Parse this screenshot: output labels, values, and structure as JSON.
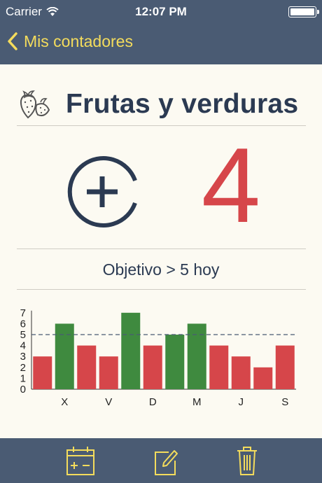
{
  "status_bar": {
    "carrier": "Carrier",
    "time": "12:07 PM"
  },
  "nav": {
    "back_label": "Mis contadores"
  },
  "counter": {
    "icon": "strawberry-icon",
    "title": "Frutas y verduras",
    "count": "4",
    "goal_text": "Objetivo > 5 hoy"
  },
  "toolbar": {
    "icons": [
      "calendar-add-icon",
      "edit-icon",
      "trash-icon"
    ]
  },
  "colors": {
    "nav_bg": "#4a5b73",
    "accent": "#f4dc5c",
    "count": "#d6464a",
    "bar_met": "#3f8a3f",
    "bar_unmet": "#d6464a",
    "goal_line": "#4a5b73"
  },
  "chart_data": {
    "type": "bar",
    "categories": [
      "",
      "X",
      "",
      "V",
      "",
      "D",
      "",
      "M",
      "",
      "J",
      "",
      "S"
    ],
    "values": [
      3,
      6,
      4,
      3,
      7,
      4,
      5,
      6,
      4,
      3,
      2,
      4
    ],
    "met": [
      false,
      true,
      false,
      false,
      true,
      false,
      true,
      true,
      false,
      false,
      false,
      false
    ],
    "ylim": [
      0,
      7
    ],
    "yticks": [
      0,
      1,
      2,
      3,
      4,
      5,
      6,
      7
    ],
    "goal": 5,
    "title": "",
    "xlabel": "",
    "ylabel": "",
    "grid": false,
    "legend": "none"
  }
}
